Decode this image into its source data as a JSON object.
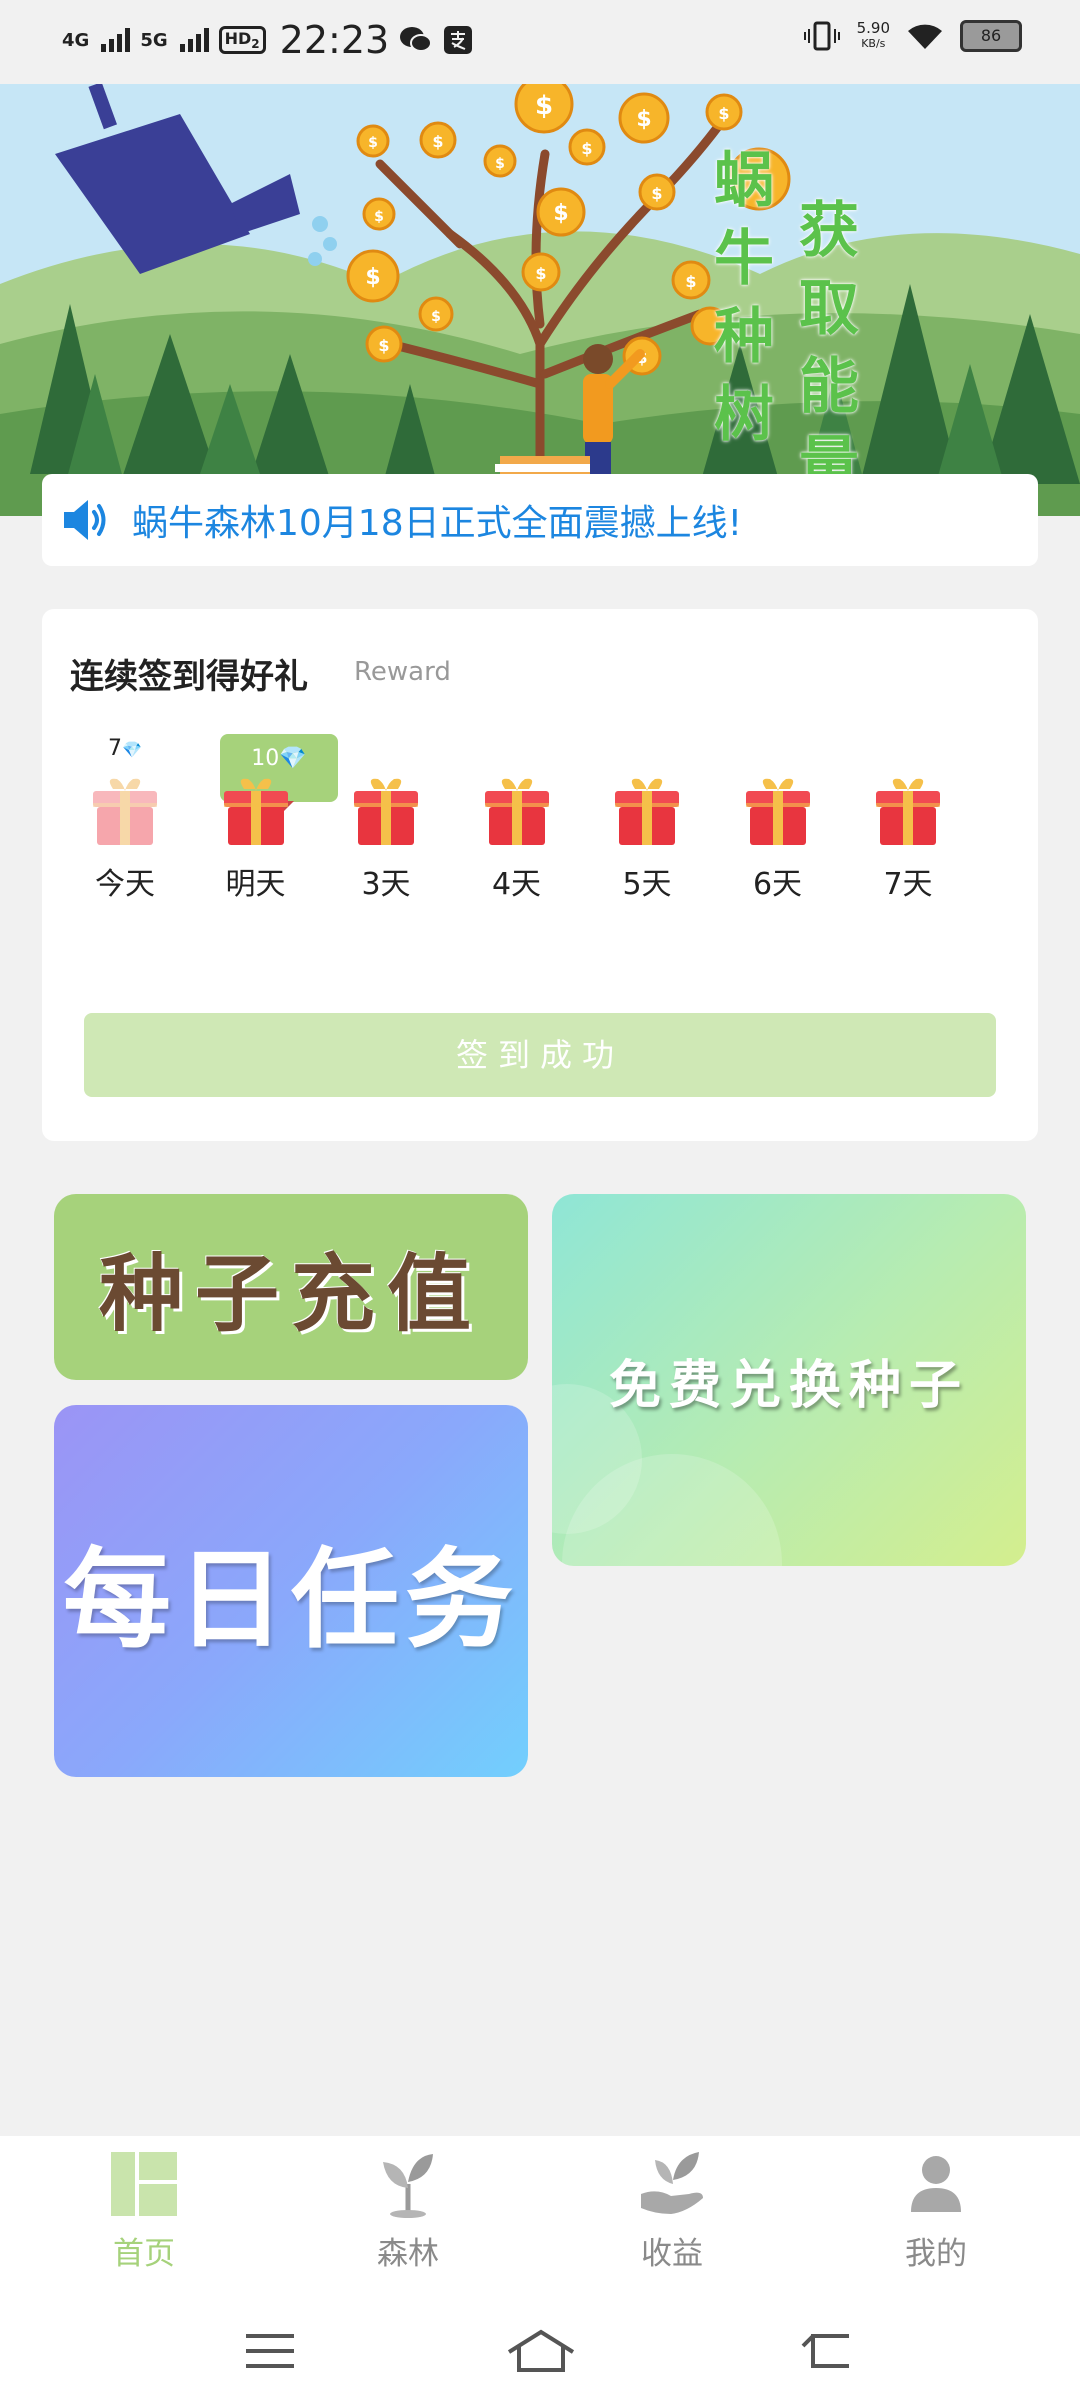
{
  "status_bar": {
    "signal_1": "4G",
    "signal_2": "5G",
    "hd": "HD",
    "hd_sub": "2",
    "time": "22:23",
    "net_speed_value": "5.90",
    "net_speed_unit": "KB/s",
    "battery": "86"
  },
  "banner": {
    "title_col1": [
      "蜗",
      "牛",
      "种",
      "树"
    ],
    "title_col2": [
      "获",
      "取",
      "能",
      "量"
    ],
    "coin_symbol": "$"
  },
  "notice": {
    "text": "蜗牛森林10月18日正式全面震撼上线!"
  },
  "checkin": {
    "title": "连续签到得好礼",
    "subtitle": "Reward",
    "days": [
      {
        "label": "今天",
        "reward": "7",
        "claimed": true
      },
      {
        "label": "明天",
        "reward": "10",
        "highlight": true
      },
      {
        "label": "3天"
      },
      {
        "label": "4天"
      },
      {
        "label": "5天"
      },
      {
        "label": "6天"
      },
      {
        "label": "7天"
      }
    ],
    "button_label": "签到成功"
  },
  "tiles": {
    "recharge": "种子充值",
    "exchange": "免费兑换种子",
    "daily": "每日任务"
  },
  "nav": {
    "items": [
      {
        "label": "首页",
        "icon": "home-grid-icon",
        "active": true
      },
      {
        "label": "森林",
        "icon": "sprout-icon"
      },
      {
        "label": "收益",
        "icon": "hand-plant-icon"
      },
      {
        "label": "我的",
        "icon": "person-icon"
      }
    ]
  },
  "colors": {
    "accent": "#a6d27b",
    "notice_text": "#1c86e0",
    "background": "#f1f1f1"
  }
}
